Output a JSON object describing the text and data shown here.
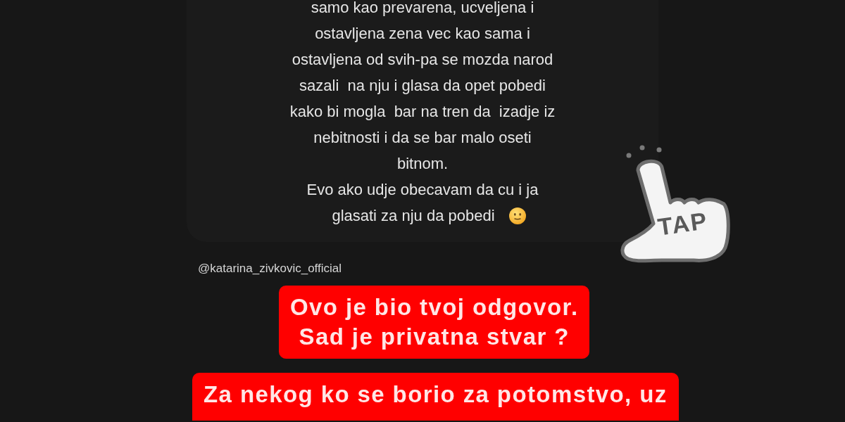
{
  "question_card": {
    "paragraphs": [
      {
        "lines": [
          "samo kao prevarena, ucveljena i",
          "ostavljena zena vec kao sama i",
          "ostavljena od svih-pa se mozda narod",
          "sazali  na nju i glasa da opet pobedi",
          "kako bi mogla  bar na tren da  izadje iz",
          "nebitnosti i da se bar malo oseti",
          "bitnom."
        ]
      },
      {
        "lines": [
          "Evo ako udje obecavam da cu i ja",
          "glasati za nju da pobedi"
        ]
      }
    ]
  },
  "mention": "@katarina_zivkovic_official",
  "reply_stickers": [
    {
      "lines": [
        "Ovo je bio tvoj odgovor.",
        "Sad je privatna stvar ?"
      ]
    },
    {
      "lines": [
        "Za nekog ko se borio za potomstvo, uz"
      ]
    }
  ],
  "tap_sticker": {
    "label": "TAP"
  }
}
